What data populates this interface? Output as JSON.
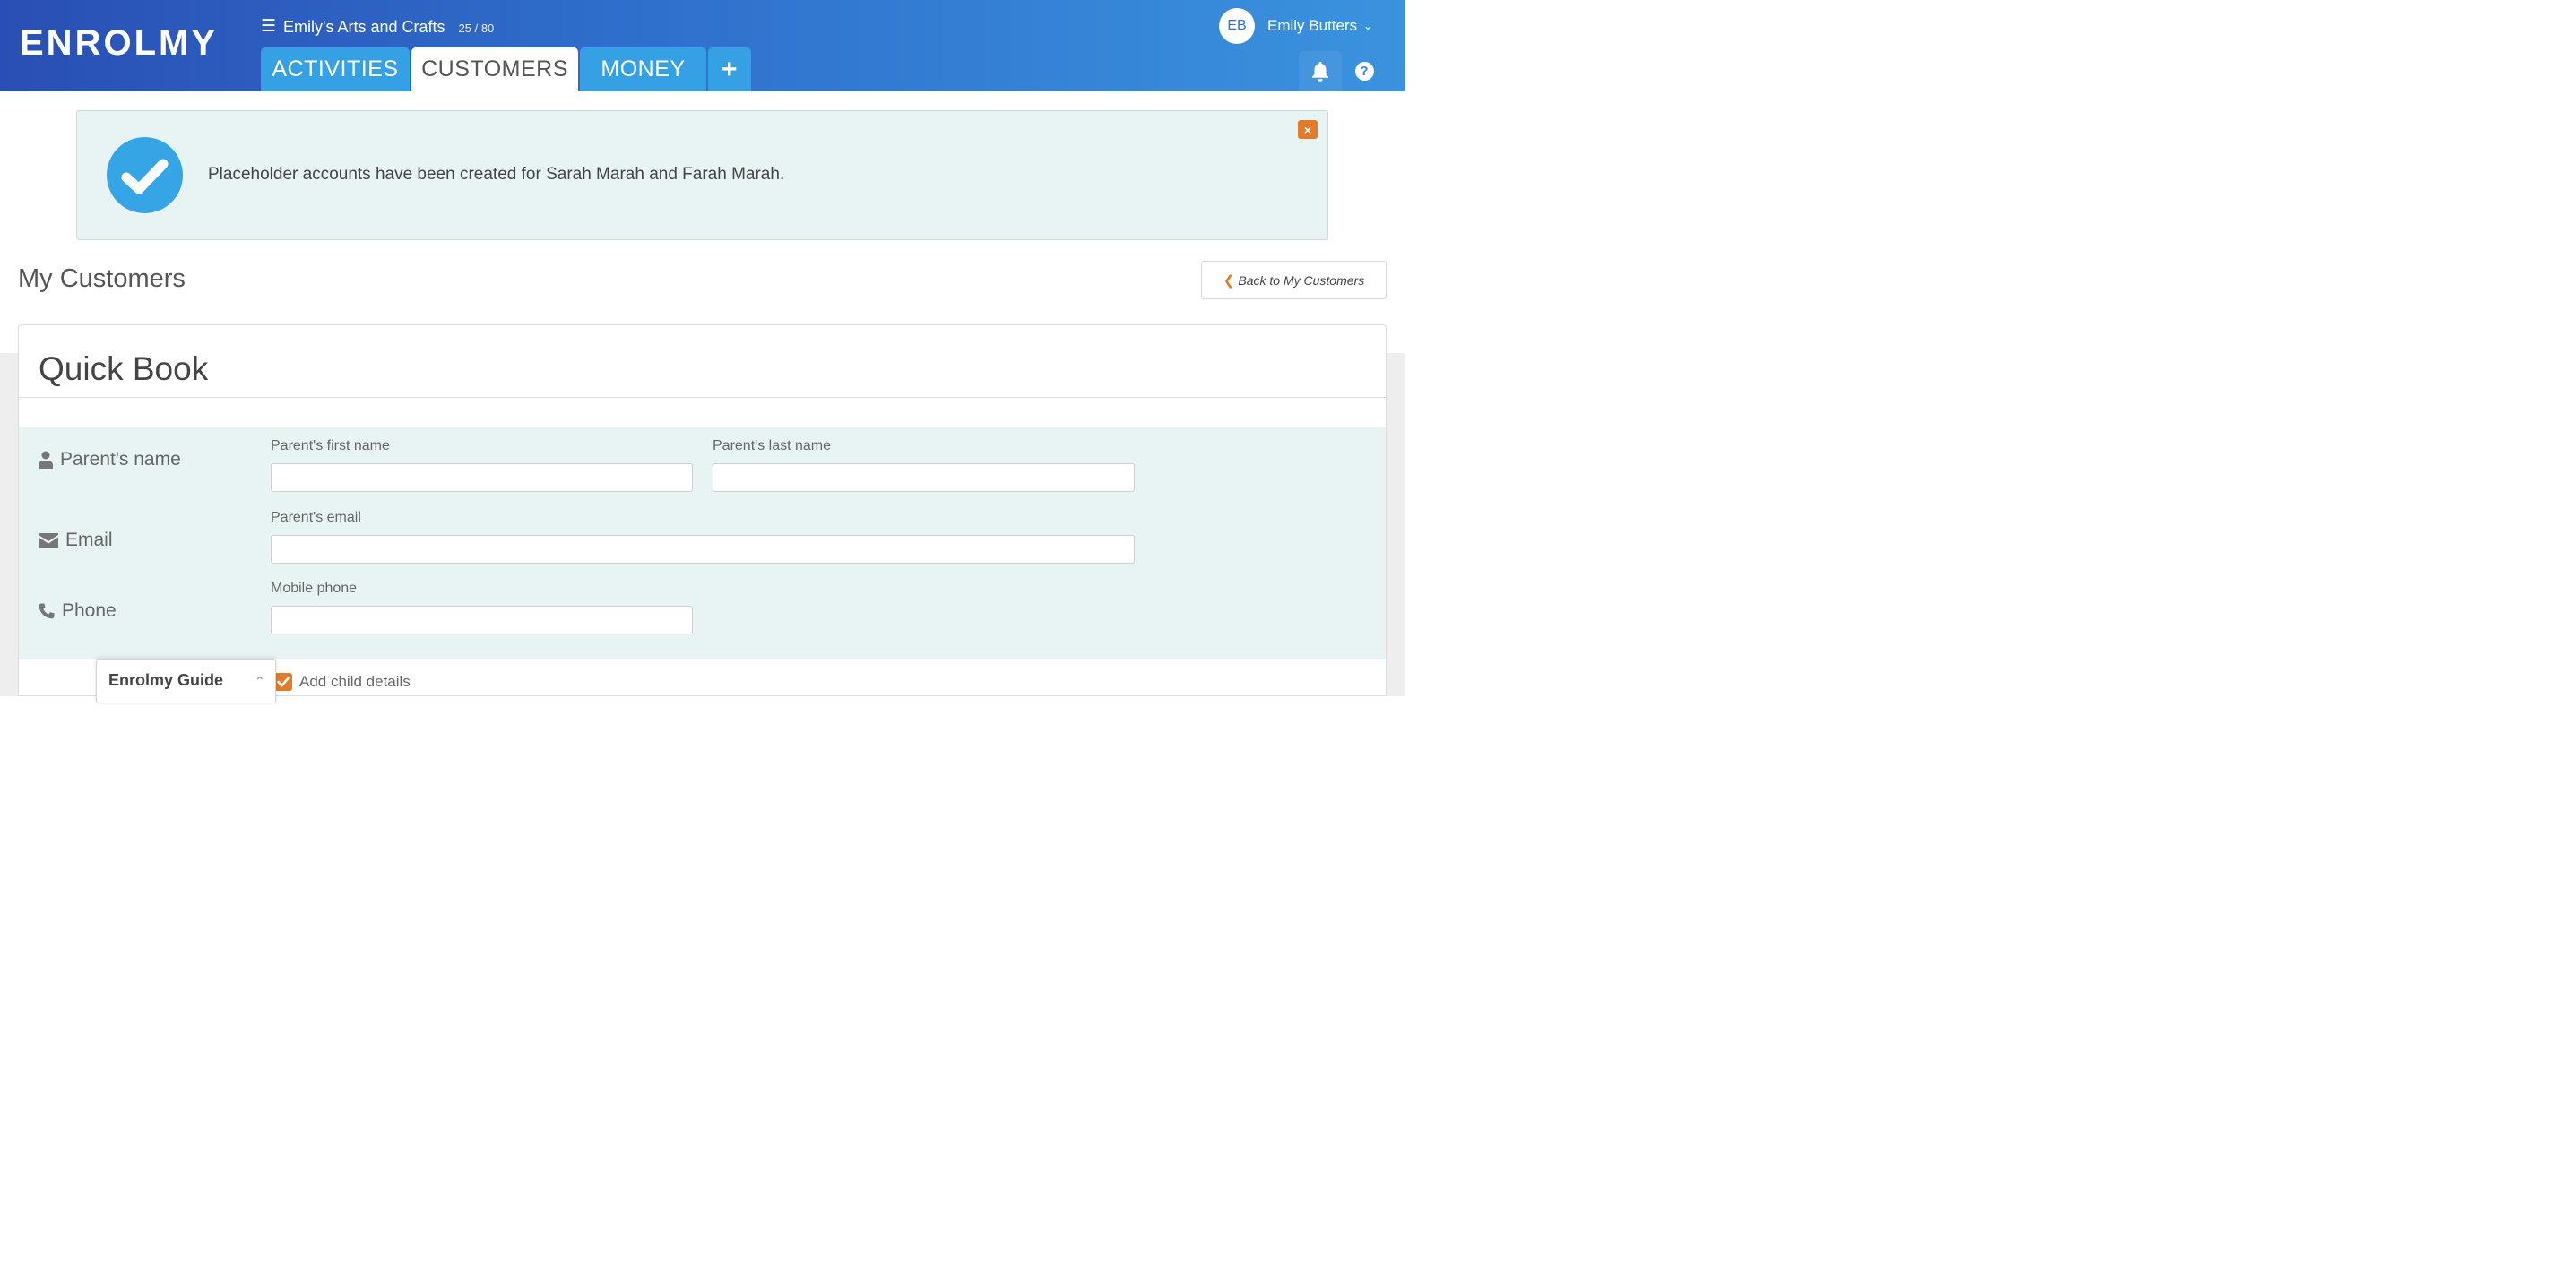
{
  "header": {
    "logo": "ENROLMY",
    "org_name": "Emily's Arts and Crafts",
    "org_count": "25 / 80",
    "tabs": [
      {
        "label": "ACTIVITIES"
      },
      {
        "label": "CUSTOMERS"
      },
      {
        "label": "MONEY"
      }
    ],
    "add_tab_label": "+",
    "user": {
      "initials": "EB",
      "name": "Emily Butters"
    }
  },
  "alert": {
    "message": "Placeholder accounts have been created for Sarah Marah and Farah Marah.",
    "close_label": "×"
  },
  "page": {
    "title": "My Customers",
    "back_button": "Back to My Customers"
  },
  "quick_book": {
    "title": "Quick Book",
    "parent_name": {
      "label": "Parent's name",
      "first_name_label": "Parent's first name",
      "first_name_value": "",
      "last_name_label": "Parent's last name",
      "last_name_value": ""
    },
    "email": {
      "label": "Email",
      "field_label": "Parent's email",
      "value": ""
    },
    "phone": {
      "label": "Phone",
      "field_label": "Mobile phone",
      "value": ""
    },
    "add_child": {
      "label": "Add child details",
      "checked": true
    }
  },
  "guide": {
    "title": "Enrolmy Guide"
  },
  "colors": {
    "header_start": "#2a4fb4",
    "header_end": "#3a93de",
    "tab": "#35a0e4",
    "accent_orange": "#e47b2a",
    "alert_bg": "#e8f4f4",
    "check_circle": "#36a5e6"
  }
}
